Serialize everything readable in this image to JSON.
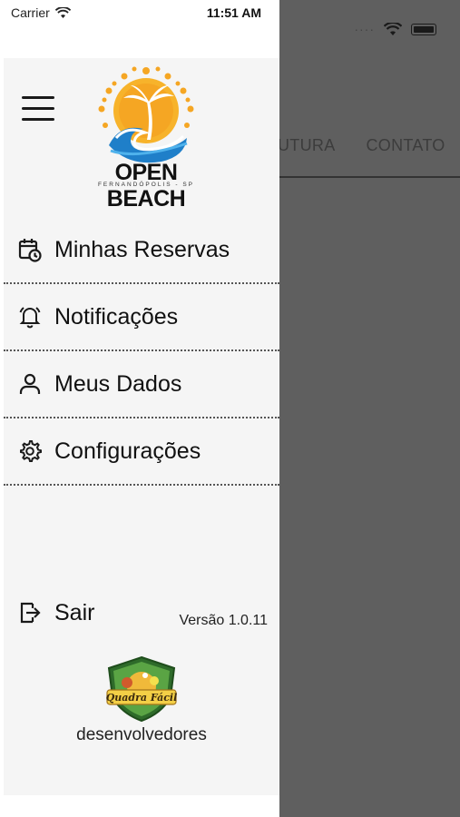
{
  "status_bar": {
    "carrier": "Carrier",
    "time": "11:51 AM"
  },
  "background": {
    "nav_tabs": [
      "UTURA",
      "CONTATO"
    ]
  },
  "logo": {
    "title": "OPEN BEACH",
    "subtitle": "FERNANDÓPOLIS - SP"
  },
  "menu": {
    "items": [
      {
        "label": "Minhas Reservas",
        "icon": "calendar-clock-icon"
      },
      {
        "label": "Notificações",
        "icon": "bell-icon"
      },
      {
        "label": "Meus Dados",
        "icon": "user-icon"
      },
      {
        "label": "Configurações",
        "icon": "gear-icon"
      }
    ]
  },
  "footer": {
    "logout_label": "Sair",
    "version": "Versão 1.0.11",
    "developer_badge_text": "Quadra Fácil",
    "developer_label": "desenvolvedores"
  },
  "colors": {
    "accent_orange": "#f5a623",
    "wave_blue": "#2b8fd6",
    "overlay": "#5f5f5f"
  }
}
